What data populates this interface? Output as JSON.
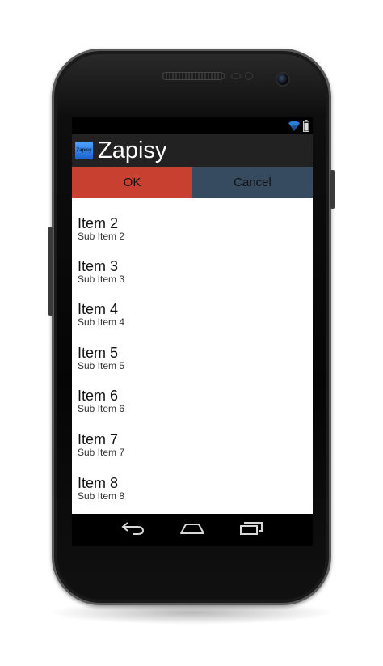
{
  "app": {
    "title": "Zapisy",
    "icon_label": "Zapisy"
  },
  "buttons": {
    "ok": "OK",
    "cancel": "Cancel"
  },
  "list": {
    "items": [
      {
        "title": "Item 2",
        "sub": "Sub Item 2"
      },
      {
        "title": "Item 3",
        "sub": "Sub Item 3"
      },
      {
        "title": "Item 4",
        "sub": "Sub Item 4"
      },
      {
        "title": "Item 5",
        "sub": "Sub Item 5"
      },
      {
        "title": "Item 6",
        "sub": "Sub Item 6"
      },
      {
        "title": "Item 7",
        "sub": "Sub Item 7"
      },
      {
        "title": "Item 8",
        "sub": "Sub Item 8"
      }
    ]
  },
  "status": {
    "wifi": "wifi-icon",
    "battery": "battery-icon"
  },
  "nav": {
    "back": "back-icon",
    "home": "home-icon",
    "recents": "recents-icon"
  },
  "colors": {
    "ok_button": "#c8402f",
    "cancel_button": "#364a60",
    "action_bar": "#222222",
    "status_bar": "#000000"
  }
}
